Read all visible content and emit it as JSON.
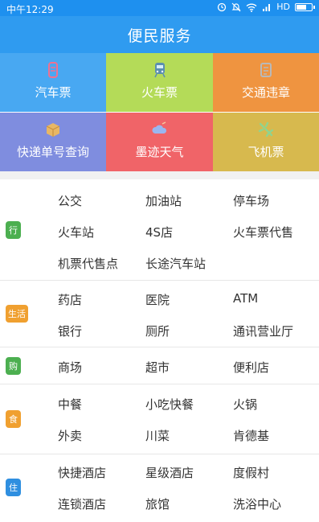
{
  "status_bar": {
    "time": "中午12:29",
    "network": "HD"
  },
  "header": {
    "title": "便民服务"
  },
  "tiles": [
    {
      "label": "汽车票",
      "icon": "bus-ticket-icon",
      "color": "#48a8f2"
    },
    {
      "label": "火车票",
      "icon": "train-icon",
      "color": "#b4db58"
    },
    {
      "label": "交通违章",
      "icon": "traffic-violation-icon",
      "color": "#ef9440"
    },
    {
      "label": "快递单号查询",
      "icon": "package-icon",
      "color": "#7f8ddf"
    },
    {
      "label": "墨迹天气",
      "icon": "weather-icon",
      "color": "#f06468"
    },
    {
      "label": "飞机票",
      "icon": "airplane-icon",
      "color": "#d7b94e"
    }
  ],
  "services": [
    {
      "tag": "行",
      "color": "#4caf50",
      "rows": [
        [
          "公交",
          "加油站",
          "停车场"
        ],
        [
          "火车站",
          "4S店",
          "火车票代售"
        ],
        [
          "机票代售点",
          "长途汽车站"
        ]
      ]
    },
    {
      "tag": "生活",
      "color": "#f0a030",
      "rows": [
        [
          "药店",
          "医院",
          "ATM"
        ],
        [
          "银行",
          "厕所",
          "通讯营业厅"
        ]
      ]
    },
    {
      "tag": "购",
      "color": "#4caf50",
      "rows": [
        [
          "商场",
          "超市",
          "便利店"
        ]
      ]
    },
    {
      "tag": "食",
      "color": "#f0a030",
      "rows": [
        [
          "中餐",
          "小吃快餐",
          "火锅"
        ],
        [
          "外卖",
          "川菜",
          "肯德基"
        ]
      ]
    },
    {
      "tag": "住",
      "color": "#2f8fe0",
      "rows": [
        [
          "快捷酒店",
          "星级酒店",
          "度假村"
        ],
        [
          "连锁酒店",
          "旅馆",
          "洗浴中心"
        ]
      ]
    }
  ]
}
